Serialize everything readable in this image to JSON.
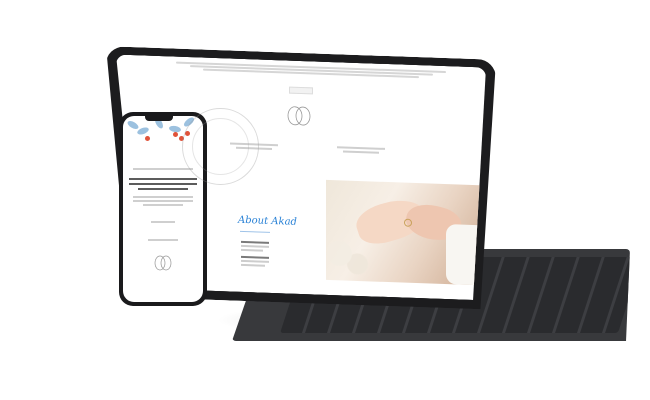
{
  "scene": {
    "description_objects": [
      "tablet",
      "keyboard",
      "phone"
    ]
  },
  "tablet": {
    "button_label": "",
    "about_heading": "About Akad"
  },
  "phone": {
    "arabic_heading": "",
    "bottom_name": ""
  },
  "colors": {
    "accent_blue": "#2a82d6",
    "device_black": "#1c1c1e",
    "keyboard_gray": "#38393c",
    "berry_red": "#e0533a",
    "leaf_blue": "#9cc1df"
  }
}
